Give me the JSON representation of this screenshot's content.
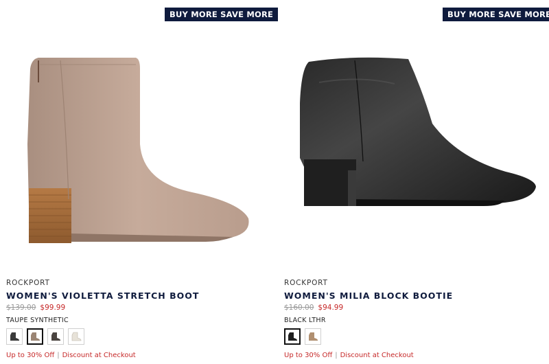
{
  "products": [
    {
      "promo_label": "BUY MORE SAVE MORE",
      "image_desc": "taupe-ankle-boot",
      "brand": "ROCKPORT",
      "name": "WOMEN'S VIOLETTA STRETCH BOOT",
      "price_original": "$139.00",
      "price_sale": "$99.99",
      "color_name": "TAUPE SYNTHETIC",
      "swatch_colors": [
        "#3a3a3a",
        "#9b8574",
        "#4a4440",
        "#e7e2d8"
      ],
      "offer_text": "Up to 30% Off",
      "offer_detail": "Discount at Checkout"
    },
    {
      "promo_label": "BUY MORE SAVE MORE",
      "image_desc": "black-block-bootie",
      "brand": "ROCKPORT",
      "name": "WOMEN'S MILIA BLOCK BOOTIE",
      "price_original": "$160.00",
      "price_sale": "$94.99",
      "color_name": "BLACK LTHR",
      "swatch_colors": [
        "#1e1e1e",
        "#b08f70"
      ],
      "offer_text": "Up to 30% Off",
      "offer_detail": "Discount at Checkout"
    }
  ],
  "colors": {
    "promo_bg": "#0f1b3d",
    "sale_red": "#c62828",
    "navy_text": "#0f1b3d"
  }
}
